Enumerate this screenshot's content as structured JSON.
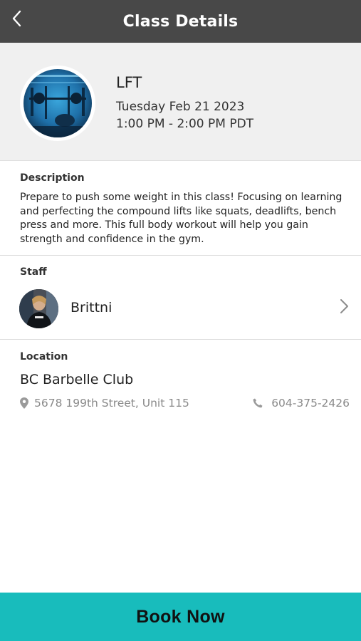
{
  "header": {
    "title": "Class Details",
    "back_icon": "chevron-left-icon"
  },
  "class_info": {
    "name": "LFT",
    "date": "Tuesday Feb 21 2023",
    "time": "1:00 PM - 2:00 PM PDT"
  },
  "description": {
    "label": "Description",
    "text": "Prepare to push some weight in this class! Focusing on learning and perfecting the compound lifts like squats, deadlifts, bench press and more. This full body workout will help you gain strength and confidence in the gym."
  },
  "staff": {
    "label": "Staff",
    "name": "Brittni"
  },
  "location": {
    "label": "Location",
    "name": "BC Barbelle Club",
    "address": "5678 199th Street, Unit 115",
    "phone": "604-375-2426"
  },
  "actions": {
    "book_label": "Book Now"
  },
  "colors": {
    "topbar": "#484848",
    "header_bg": "#f0f0f0",
    "accent": "#18bcbc",
    "muted_text": "#8a8a8a"
  }
}
